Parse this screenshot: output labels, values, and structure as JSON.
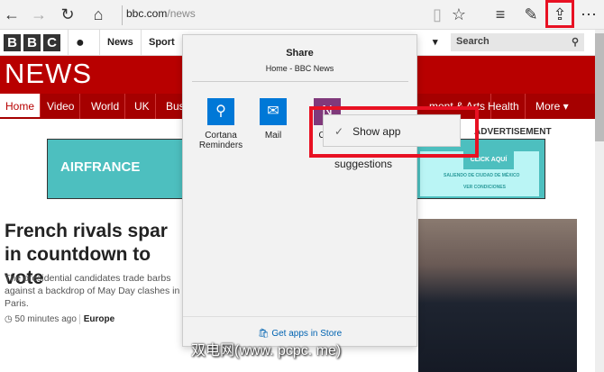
{
  "browser": {
    "url_host": "bbc.com",
    "url_path": "/news"
  },
  "bbc": {
    "logo": [
      "B",
      "B",
      "C"
    ],
    "top_nav": [
      "News",
      "Sport"
    ],
    "search_placeholder": "Search",
    "news_title": "NEWS",
    "nav": [
      "Home",
      "Video",
      "World",
      "UK",
      "Bus",
      "ment & Arts",
      "Health",
      "More ▾"
    ]
  },
  "ad": {
    "brand": "AIRFRANCE",
    "cta": "CLICK AQUÍ",
    "line1": "SALIENDO DE  CIUDAD DE MÉXICO",
    "line2": "VER CONDICIONES",
    "label": "ADVERTISEMENT"
  },
  "story": {
    "headline": "French rivals spar in countdown to vote",
    "summary": "The presidential candidates trade barbs against a backdrop of May Day clashes in Paris.",
    "time": "50 minutes ago",
    "section": "Europe"
  },
  "share": {
    "title": "Share",
    "subtitle": "Home - BBC News",
    "apps": [
      {
        "label": "Cortana Reminders"
      },
      {
        "label": "Mail"
      },
      {
        "label": "One"
      }
    ],
    "store_link": "Get apps in Store"
  },
  "context_menu": {
    "item": "Show app suggestions",
    "checked": true
  },
  "watermark": "双电网(www. pcpc. me)"
}
